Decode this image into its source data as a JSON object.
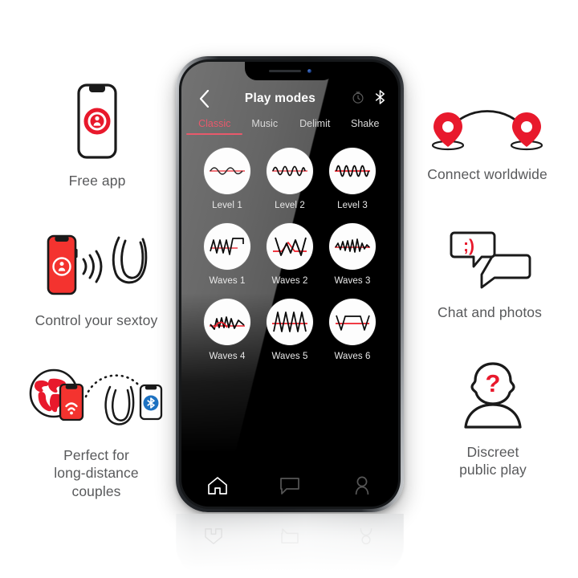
{
  "colors": {
    "brand_red": "#e8192c",
    "accent_pink": "#e8596b",
    "caption_gray": "#58595b",
    "bluetooth_blue": "#1d72c2",
    "screen_black": "#000000"
  },
  "phone": {
    "appbar": {
      "back_label": "‹",
      "title": "Play modes",
      "actions": [
        {
          "name": "timer-icon",
          "label": "timer-icon"
        },
        {
          "name": "bluetooth-icon",
          "label": "bluetooth-icon"
        }
      ]
    },
    "tabs": [
      {
        "label": "Classic",
        "active": true
      },
      {
        "label": "Music",
        "active": false
      },
      {
        "label": "Delimit",
        "active": false
      },
      {
        "label": "Shake",
        "active": false
      }
    ],
    "modes": [
      {
        "label": "Level 1",
        "icon": "waveform-level-1-icon"
      },
      {
        "label": "Level 2",
        "icon": "waveform-level-2-icon"
      },
      {
        "label": "Level 3",
        "icon": "waveform-level-3-icon"
      },
      {
        "label": "Waves 1",
        "icon": "waveform-waves-1-icon"
      },
      {
        "label": "Waves 2",
        "icon": "waveform-waves-2-icon"
      },
      {
        "label": "Waves 3",
        "icon": "waveform-waves-3-icon"
      },
      {
        "label": "Waves 4",
        "icon": "waveform-waves-4-icon"
      },
      {
        "label": "Waves 5",
        "icon": "waveform-waves-5-icon"
      },
      {
        "label": "Waves 6",
        "icon": "waveform-waves-6-icon"
      }
    ],
    "bottom_nav": [
      {
        "name": "nav-home",
        "icon": "home-icon",
        "active": true
      },
      {
        "name": "nav-chat",
        "icon": "chat-icon",
        "active": false
      },
      {
        "name": "nav-profile",
        "icon": "profile-icon",
        "active": false
      }
    ]
  },
  "features": {
    "free_app": {
      "caption": "Free app",
      "icon": "phone-with-app-logo-icon"
    },
    "control": {
      "caption": "Control your sextoy",
      "icon": "phone-signal-toy-icon"
    },
    "long_dist": {
      "caption": "Perfect for\nlong-distance\ncouples",
      "icon": "globe-phone-toy-bluetooth-icon"
    },
    "connect": {
      "caption": "Connect worldwide",
      "icon": "two-map-pins-arc-icon"
    },
    "chat": {
      "caption": "Chat and photos",
      "icon": "speech-bubbles-wink-icon"
    },
    "discreet": {
      "caption": "Discreet\npublic play",
      "icon": "anonymous-person-question-icon"
    }
  }
}
